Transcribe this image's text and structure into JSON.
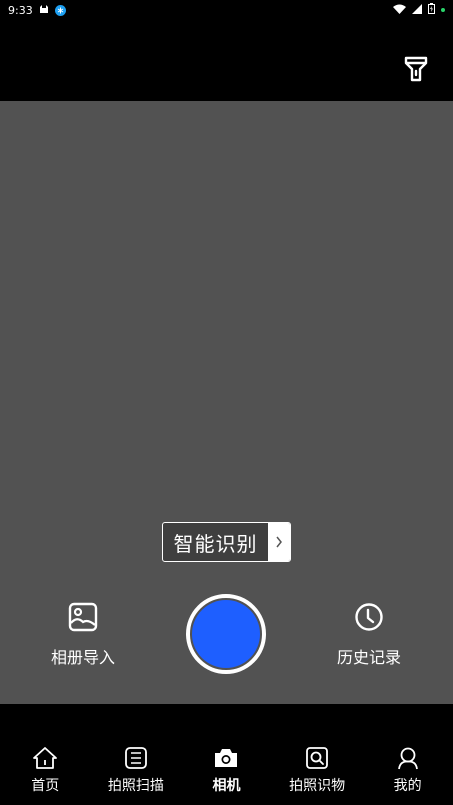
{
  "status_bar": {
    "time": "9:33"
  },
  "top_bar": {
    "flashlight_icon": "flashlight-icon"
  },
  "camera": {
    "smart_recognition_label": "智能识别",
    "album_import_label": "相册导入",
    "history_label": "历史记录",
    "shutter_color": "#1e5fff"
  },
  "bottom_nav": {
    "items": [
      {
        "label": "首页",
        "icon": "home-icon"
      },
      {
        "label": "拍照扫描",
        "icon": "scan-icon"
      },
      {
        "label": "相机",
        "icon": "camera-icon",
        "active": true
      },
      {
        "label": "拍照识物",
        "icon": "object-search-icon"
      },
      {
        "label": "我的",
        "icon": "profile-icon"
      }
    ]
  }
}
